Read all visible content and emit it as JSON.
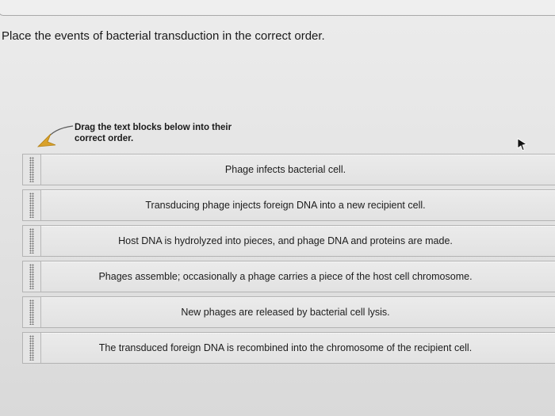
{
  "question": {
    "text": "Place the events of bacterial transduction in the correct order."
  },
  "instruction": {
    "text": "Drag the text blocks below into their correct order.",
    "icon": "curved-arrow-icon",
    "icon_color": "#d9a12a"
  },
  "cursor": {
    "icon": "mouse-pointer-icon"
  },
  "blocks": [
    {
      "label": "Phage infects bacterial cell."
    },
    {
      "label": "Transducing phage injects foreign DNA into a new recipient cell."
    },
    {
      "label": "Host DNA is hydrolyzed into pieces, and phage DNA and proteins are made."
    },
    {
      "label": "Phages assemble; occasionally a phage carries a piece of the host cell chromosome."
    },
    {
      "label": "New phages are released by bacterial cell lysis."
    },
    {
      "label": "The transduced foreign DNA is recombined into the chromosome of the recipient cell."
    }
  ]
}
